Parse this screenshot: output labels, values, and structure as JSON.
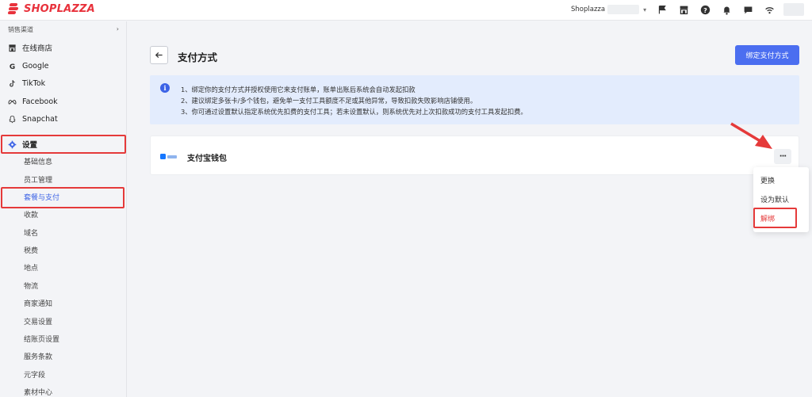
{
  "header": {
    "brand": "SHOPLAZZA",
    "store_name": "Shoplazza",
    "icons": [
      "flag-icon",
      "store-icon",
      "help-icon",
      "bell-icon",
      "message-icon",
      "wifi-icon"
    ]
  },
  "sidebar": {
    "section_label": "销售渠道",
    "channels": [
      {
        "label": "在线商店",
        "icon": "store-icon"
      },
      {
        "label": "Google",
        "icon": "google-icon"
      },
      {
        "label": "TikTok",
        "icon": "tiktok-icon"
      },
      {
        "label": "Facebook",
        "icon": "meta-icon"
      },
      {
        "label": "Snapchat",
        "icon": "snapchat-icon"
      }
    ],
    "settings_label": "设置",
    "sub_items": [
      "基础信息",
      "员工管理",
      "套餐与支付",
      "收款",
      "域名",
      "税费",
      "地点",
      "物流",
      "商家通知",
      "交易设置",
      "结账页设置",
      "服务条款",
      "元字段",
      "素材中心"
    ],
    "active_sub_item": "套餐与支付"
  },
  "page": {
    "title": "支付方式",
    "primary_button": "绑定支付方式",
    "info_lines": [
      "1、绑定你的支付方式并授权使用它来支付账单，账单出账后系统会自动发起扣款",
      "2、建议绑定多张卡/多个钱包，避免单一支付工具额度不足或其他异常，导致扣款失败影响店铺使用。",
      "3、你可通过设置默认指定系统优先扣费的支付工具；若未设置默认，则系统优先对上次扣款成功的支付工具发起扣费。"
    ],
    "payment_method": "支付宝钱包",
    "more_button": "···",
    "menu": [
      "更换",
      "设为默认",
      "解绑"
    ]
  },
  "colors": {
    "brand_red": "#e8323c",
    "primary_blue": "#4b6ef0",
    "highlight_red": "#e53a3a",
    "info_bg": "#e3ecfd"
  }
}
